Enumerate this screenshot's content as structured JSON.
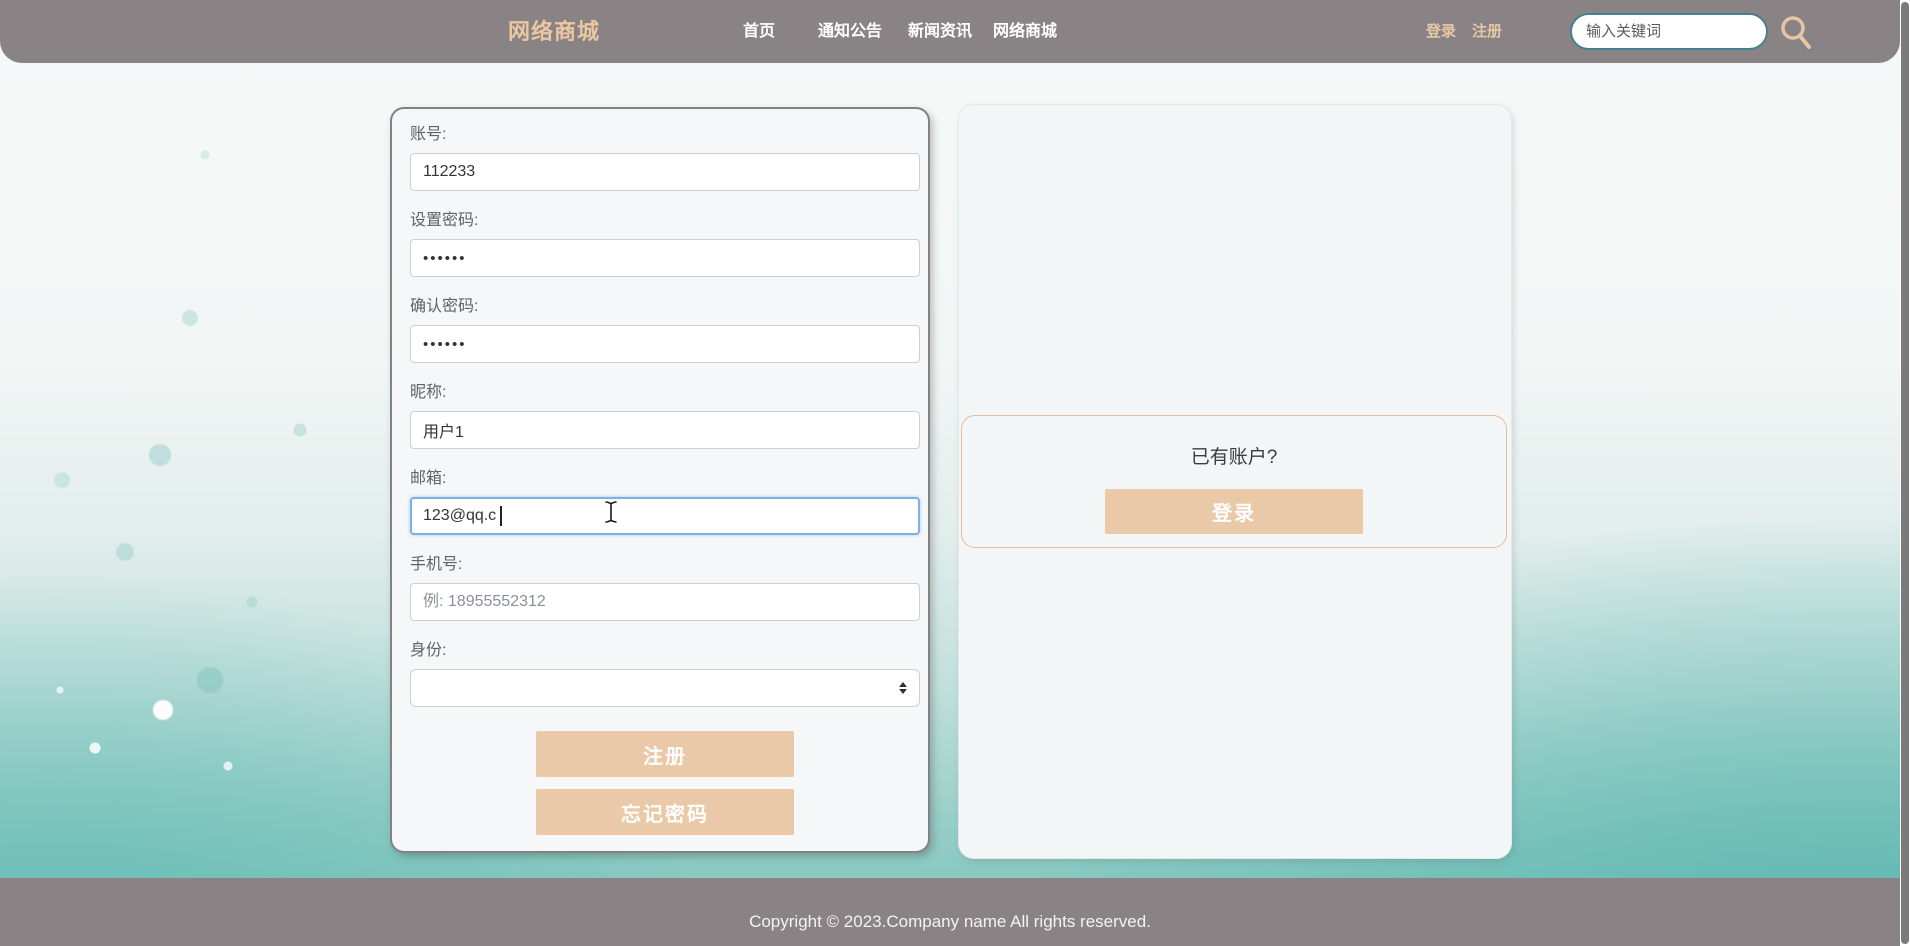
{
  "navbar": {
    "logo": "网络商城",
    "items": [
      {
        "label": "首页"
      },
      {
        "label": "通知公告"
      },
      {
        "label": "新闻资讯"
      },
      {
        "label": "网络商城"
      }
    ],
    "login_link": "登录",
    "register_link": "注册",
    "search_placeholder": "输入关键词",
    "search_icon": "magnifier-icon"
  },
  "register_form": {
    "fields": [
      {
        "label": "账号:",
        "value": "112233",
        "type": "text"
      },
      {
        "label": "设置密码:",
        "value": "••••••",
        "type": "password"
      },
      {
        "label": "确认密码:",
        "value": "••••••",
        "type": "password"
      },
      {
        "label": "昵称:",
        "value": "用户1",
        "type": "text"
      },
      {
        "label": "邮箱:",
        "value": "123@qq.c",
        "type": "text",
        "focused": true
      },
      {
        "label": "手机号:",
        "value": "",
        "placeholder": "例: 18955552312",
        "type": "text"
      },
      {
        "label": "身份:",
        "value": "",
        "type": "select",
        "icon": "up-down-arrows-icon"
      }
    ],
    "register_button": "注册",
    "forgot_button": "忘记密码"
  },
  "login_panel": {
    "prompt": "已有账户?",
    "login_button": "登录"
  },
  "footer": {
    "copyright": "Copyright © 2023.Company name All rights reserved."
  },
  "colors": {
    "navbar_bg": "#8a8385",
    "accent_tan": "#eac9a8",
    "logo_tan": "#eac7a2",
    "search_border_teal": "#44808f",
    "focus_blue": "#7fb1e3",
    "background_teal": "#66bcb5"
  }
}
